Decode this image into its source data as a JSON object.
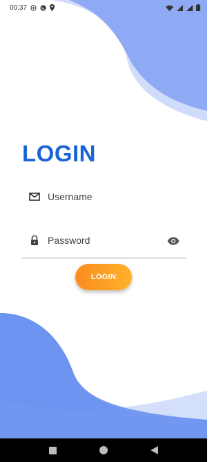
{
  "status_bar": {
    "time": "00:37",
    "left_icons": [
      "whatsapp-icon",
      "phone-icon",
      "location-icon"
    ],
    "right_icons": [
      "wifi-icon",
      "signal-icon",
      "signal-icon",
      "battery-icon"
    ]
  },
  "login": {
    "title": "LOGIN",
    "username_placeholder": "Username",
    "password_placeholder": "Password",
    "button_label": "LOGIN"
  },
  "icons": {
    "username": "mail-icon",
    "password": "lock-icon",
    "visibility": "eye-icon"
  },
  "nav": [
    "recent-apps-icon",
    "home-icon",
    "back-icon"
  ],
  "colors": {
    "title": "#1b63d6",
    "wave_light": "#cfdcfb",
    "wave_dark": "#8eaaf4",
    "button_start": "#fb8c1e",
    "button_end": "#ffb12c"
  }
}
